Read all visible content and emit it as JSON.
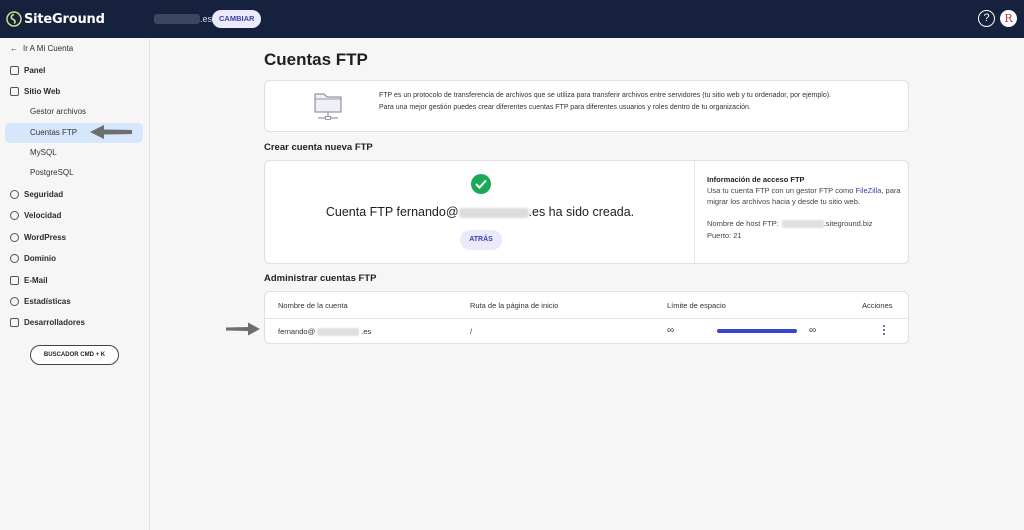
{
  "header": {
    "logo_text": "SiteGround",
    "site_suffix": ".es",
    "change_label": "CAMBIAR",
    "help_glyph": "?",
    "avatar_initial": "R"
  },
  "sidebar": {
    "back_label": "Ir A Mi Cuenta",
    "items": [
      {
        "label": "Panel",
        "icon": "grid-icon"
      },
      {
        "label": "Sitio Web",
        "icon": "website-icon"
      },
      {
        "label": "Seguridad",
        "icon": "lock-icon"
      },
      {
        "label": "Velocidad",
        "icon": "rocket-icon"
      },
      {
        "label": "WordPress",
        "icon": "wordpress-icon"
      },
      {
        "label": "Dominio",
        "icon": "globe-icon"
      },
      {
        "label": "E-Mail",
        "icon": "mail-icon"
      },
      {
        "label": "Estadísticas",
        "icon": "chart-icon"
      },
      {
        "label": "Desarrolladores",
        "icon": "code-icon"
      }
    ],
    "sub_items": [
      "Gestor archivos",
      "Cuentas FTP",
      "MySQL",
      "PostgreSQL"
    ],
    "search_label": "BUSCADOR CMD + K"
  },
  "main": {
    "title": "Cuentas FTP",
    "info_line1": "FTP es un protocolo de transferencia de archivos que se utiliza para transferir archivos entre servidores (tu sitio web y tu ordenador, por ejemplo).",
    "info_line2": "Para una mejor gestión puedes crear diferentes cuentas FTP para diferentes usuarios y roles dentro de tu organización.",
    "create_heading": "Crear cuenta nueva FTP",
    "created_prefix": "Cuenta FTP fernando@",
    "created_suffix": ".es ha sido creada.",
    "back_button": "ATRÁS",
    "access_title": "Información de acceso FTP",
    "access_text_1": "Usa tu cuenta FTP con un gestor FTP como ",
    "access_link": "FileZilla",
    "access_text_2": ", para migrar los archivos hacia y desde tu sitio web.",
    "host_label": "Nombre de host FTP:",
    "host_suffix": ".siteground.biz",
    "port_line": "Puerto: 21",
    "manage_heading": "Administrar cuentas FTP",
    "table": {
      "headers": [
        "Nombre de la cuenta",
        "Ruta de la página de inicio",
        "Límite de espacio",
        "Acciones"
      ],
      "row": {
        "account_prefix": "fernando@",
        "account_suffix": ".es",
        "path": "/",
        "used": "∞",
        "limit": "∞",
        "usage_fraction": 1.0
      }
    }
  },
  "colors": {
    "topbar": "#16213d",
    "accent": "#3b3fa8",
    "success": "#1aaa55",
    "active_nav": "#d6e6fb"
  }
}
